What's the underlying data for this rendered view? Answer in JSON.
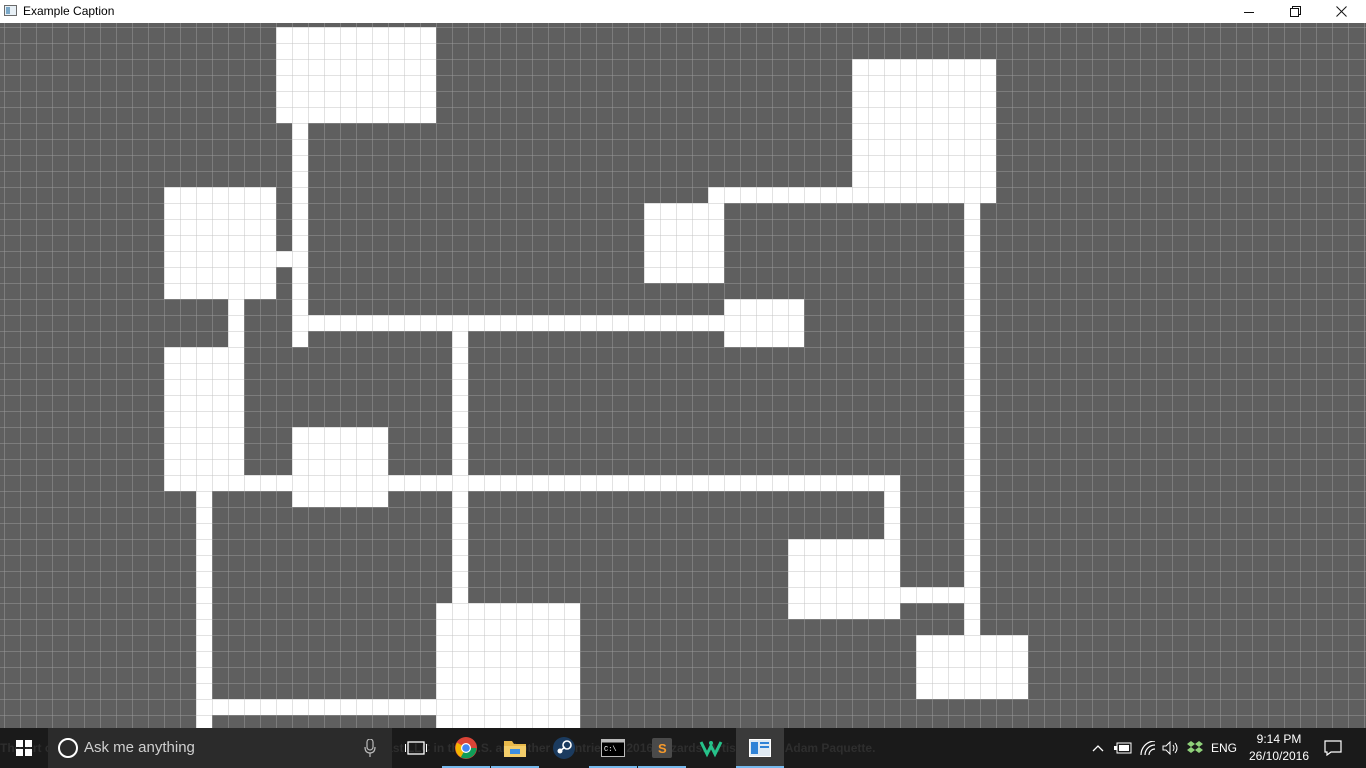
{
  "window": {
    "title": "Example Caption",
    "controls": {
      "minimize": "minimize-icon",
      "restore": "restore-icon",
      "close": "close-icon"
    }
  },
  "map": {
    "colors": {
      "background": "#5f5f5f",
      "grid": "#9a9a9a",
      "floor": "#ffffff",
      "floor_grid": "#c4c4c4"
    },
    "cell_size": 16,
    "rooms": [
      {
        "name": "room-top-center",
        "col": 17,
        "row": 0,
        "w": 10,
        "h": 6
      },
      {
        "name": "room-top-right",
        "col": 53,
        "row": 2,
        "w": 9,
        "h": 9
      },
      {
        "name": "room-left-upper",
        "col": 10,
        "row": 10,
        "w": 7,
        "h": 7
      },
      {
        "name": "room-center-small",
        "col": 40,
        "row": 11,
        "w": 5,
        "h": 5
      },
      {
        "name": "room-center-right",
        "col": 45,
        "row": 17,
        "w": 5,
        "h": 3
      },
      {
        "name": "room-left-middle",
        "col": 10,
        "row": 20,
        "w": 5,
        "h": 9
      },
      {
        "name": "room-center-left",
        "col": 18,
        "row": 25,
        "w": 6,
        "h": 5
      },
      {
        "name": "room-lower-right",
        "col": 49,
        "row": 32,
        "w": 7,
        "h": 5
      },
      {
        "name": "room-bottom-right",
        "col": 57,
        "row": 38,
        "w": 7,
        "h": 4
      },
      {
        "name": "room-bottom-center",
        "col": 27,
        "row": 36,
        "w": 9,
        "h": 8
      }
    ],
    "corridors": [
      {
        "col": 18,
        "row": 6,
        "w": 1,
        "h": 14
      },
      {
        "col": 18,
        "row": 18,
        "w": 27,
        "h": 1
      },
      {
        "col": 17,
        "row": 14,
        "w": 1,
        "h": 1
      },
      {
        "col": 14,
        "row": 17,
        "w": 1,
        "h": 3
      },
      {
        "col": 28,
        "row": 19,
        "w": 1,
        "h": 17
      },
      {
        "col": 10,
        "row": 28,
        "w": 46,
        "h": 1
      },
      {
        "col": 55,
        "row": 28,
        "w": 1,
        "h": 4
      },
      {
        "col": 12,
        "row": 29,
        "w": 1,
        "h": 15
      },
      {
        "col": 12,
        "row": 42,
        "w": 15,
        "h": 1
      },
      {
        "col": 44,
        "row": 10,
        "w": 9,
        "h": 1
      },
      {
        "col": 60,
        "row": 11,
        "w": 1,
        "h": 27
      },
      {
        "col": 56,
        "row": 35,
        "w": 4,
        "h": 1
      }
    ]
  },
  "taskbar": {
    "background_text": "The Art of Magic: The Gathering is a trademark of Wizards of the Coast LLC in the U.S. and other countries. © 2016 Wizards. Artist Credit: Adam Paquette.",
    "start": "windows-logo-icon",
    "search_placeholder": "Ask me anything",
    "apps": [
      {
        "name": "task-view",
        "icon": "task-view-icon"
      },
      {
        "name": "chrome",
        "icon": "chrome-icon"
      },
      {
        "name": "file-explorer",
        "icon": "folder-icon"
      },
      {
        "name": "steam",
        "icon": "steam-icon"
      },
      {
        "name": "command-prompt",
        "icon": "terminal-icon"
      },
      {
        "name": "sublime-text",
        "icon": "sublime-icon"
      },
      {
        "name": "gitkraken",
        "icon": "gitkraken-icon"
      },
      {
        "name": "example-app",
        "icon": "app-window-icon"
      }
    ],
    "tray": {
      "language": "ENG",
      "time": "9:14 PM",
      "date": "26/10/2016"
    }
  }
}
